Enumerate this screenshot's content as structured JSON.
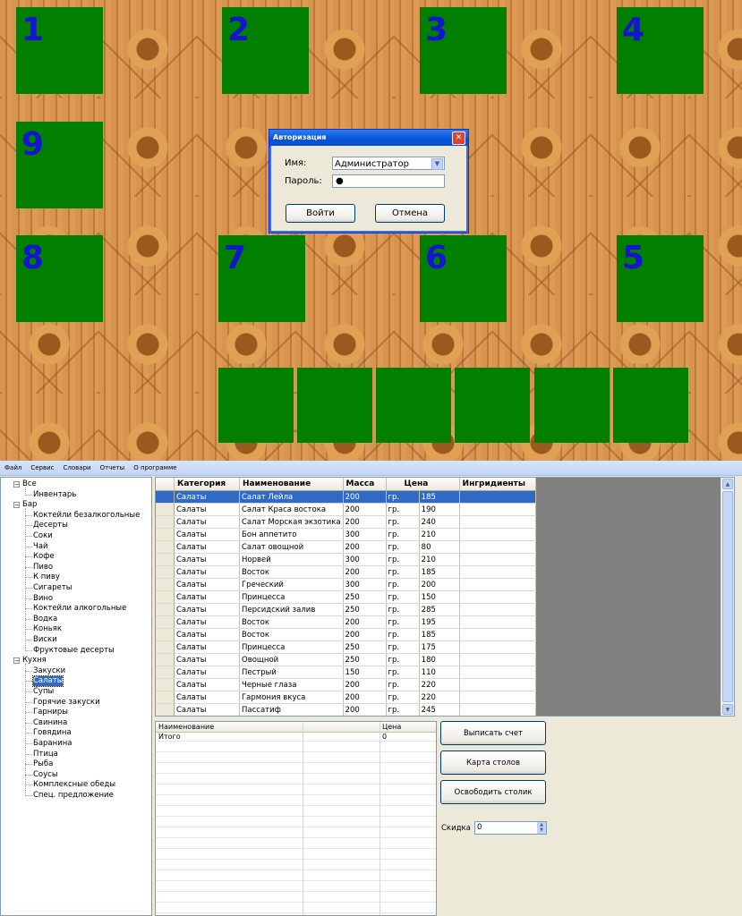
{
  "floor": {
    "tables": [
      "1",
      "2",
      "3",
      "4",
      "9",
      "8",
      "7",
      "6",
      "5"
    ],
    "unnumbered_tables": 6,
    "table_color": "#007f00",
    "number_color": "#1515d0"
  },
  "login_dialog": {
    "title": "Авторизация",
    "close": "✕",
    "name_label": "Имя:",
    "name_value": "Администратор",
    "password_label": "Пароль:",
    "password_value": "●",
    "login_button": "Войти",
    "cancel_button": "Отмена"
  },
  "menu": [
    "Файл",
    "Сервис",
    "Словари",
    "Отчеты",
    "О программе"
  ],
  "tree": [
    {
      "label": "Все",
      "level": 0,
      "expander": "⊟"
    },
    {
      "label": "Инвентарь",
      "level": 1
    },
    {
      "label": "Бар",
      "level": 0,
      "expander": "⊟"
    },
    {
      "label": "Коктейли безалкогольные",
      "level": 1
    },
    {
      "label": "Десерты",
      "level": 1
    },
    {
      "label": "Соки",
      "level": 1
    },
    {
      "label": "Чай",
      "level": 1
    },
    {
      "label": "Кофе",
      "level": 1
    },
    {
      "label": "Пиво",
      "level": 1
    },
    {
      "label": "К пиву",
      "level": 1
    },
    {
      "label": "Сигареты",
      "level": 1
    },
    {
      "label": "Вино",
      "level": 1
    },
    {
      "label": "Коктейли алкогольные",
      "level": 1
    },
    {
      "label": "Водка",
      "level": 1
    },
    {
      "label": "Коньяк",
      "level": 1
    },
    {
      "label": "Виски",
      "level": 1
    },
    {
      "label": "Фруктовые десерты",
      "level": 1
    },
    {
      "label": "Кухня",
      "level": 0,
      "expander": "⊟"
    },
    {
      "label": "Закуски",
      "level": 1
    },
    {
      "label": "Салаты",
      "level": 1,
      "selected": true
    },
    {
      "label": "Супы",
      "level": 1
    },
    {
      "label": "Горячие закуски",
      "level": 1
    },
    {
      "label": "Гарниры",
      "level": 1
    },
    {
      "label": "Свинина",
      "level": 1
    },
    {
      "label": "Говядина",
      "level": 1
    },
    {
      "label": "Баранина",
      "level": 1
    },
    {
      "label": "Птица",
      "level": 1
    },
    {
      "label": "Рыба",
      "level": 1
    },
    {
      "label": "Соусы",
      "level": 1
    },
    {
      "label": "Комплексные обеды",
      "level": 1
    },
    {
      "label": "Спец. предложение",
      "level": 1
    }
  ],
  "grid": {
    "columns": [
      "Категория",
      "Наименование",
      "Масса",
      "Цена",
      "Ингридиенты"
    ],
    "rows": [
      [
        "Салаты",
        "Салат Лейла",
        "200",
        "гр.",
        "185"
      ],
      [
        "Салаты",
        "Салат Краса востока",
        "200",
        "гр.",
        "190"
      ],
      [
        "Салаты",
        "Салат Морская экзотика",
        "200",
        "гр.",
        "240"
      ],
      [
        "Салаты",
        "Бон аппетито",
        "300",
        "гр.",
        "210"
      ],
      [
        "Салаты",
        "Салат овощной",
        "200",
        "гр.",
        "80"
      ],
      [
        "Салаты",
        "Норвей",
        "300",
        "гр.",
        "210"
      ],
      [
        "Салаты",
        "Восток",
        "200",
        "гр.",
        "185"
      ],
      [
        "Салаты",
        "Греческий",
        "300",
        "гр.",
        "200"
      ],
      [
        "Салаты",
        "Принцесса",
        "250",
        "гр.",
        "150"
      ],
      [
        "Салаты",
        "Персидский залив",
        "250",
        "гр.",
        "285"
      ],
      [
        "Салаты",
        "Восток",
        "200",
        "гр.",
        "195"
      ],
      [
        "Салаты",
        "Восток",
        "200",
        "гр.",
        "185"
      ],
      [
        "Салаты",
        "Принцесса",
        "250",
        "гр.",
        "175"
      ],
      [
        "Салаты",
        "Овощной",
        "250",
        "гр.",
        "180"
      ],
      [
        "Салаты",
        "Пестрый",
        "150",
        "гр.",
        "110"
      ],
      [
        "Салаты",
        "Черные глаза",
        "200",
        "гр.",
        "220"
      ],
      [
        "Салаты",
        "Гармония вкуса",
        "200",
        "гр.",
        "220"
      ],
      [
        "Салаты",
        "Пассатиф",
        "200",
        "гр.",
        "245"
      ]
    ],
    "selected_row": 0
  },
  "bill": {
    "col_name": "Наименование",
    "col_price": "Цена",
    "total_label": "Итого",
    "total_value": "0"
  },
  "actions": {
    "issue_bill": "Выписать счет",
    "table_map": "Карта столов",
    "free_table": "Освободить столик"
  },
  "discount": {
    "label": "Скидка",
    "value": "0"
  }
}
